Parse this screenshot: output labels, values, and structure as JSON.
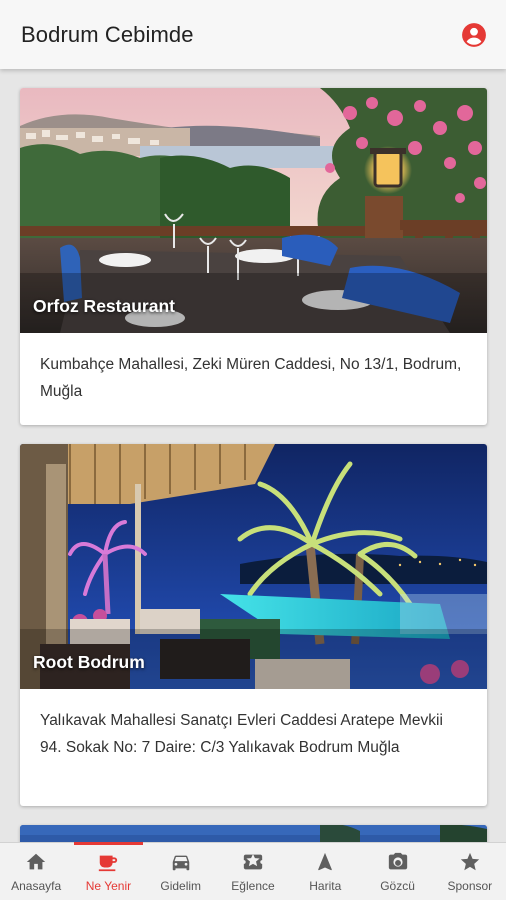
{
  "app": {
    "title": "Bodrum Cebimde",
    "accent_color": "#e53935",
    "account_icon": "account-circle-icon"
  },
  "places": [
    {
      "name": "Orfoz Restaurant",
      "address": "Kumbahçe Mahallesi, Zeki Müren Caddesi, No 13/1, Bodrum, Muğla"
    },
    {
      "name": "Root Bodrum",
      "address": "Yalıkavak Mahallesi Sanatçı Evleri Caddesi Aratepe Mevkii 94. Sokak No: 7 Daire: C/3 Yalıkavak Bodrum Muğla"
    }
  ],
  "nav": {
    "items": [
      {
        "label": "Anasayfa",
        "icon": "home-icon"
      },
      {
        "label": "Ne Yenir",
        "icon": "coffee-cup-icon",
        "active": true
      },
      {
        "label": "Gidelim",
        "icon": "car-icon"
      },
      {
        "label": "Eğlence",
        "icon": "ticket-icon"
      },
      {
        "label": "Harita",
        "icon": "navigation-icon"
      },
      {
        "label": "Gözcü",
        "icon": "camera-icon"
      },
      {
        "label": "Sponsor",
        "icon": "star-icon"
      }
    ]
  }
}
